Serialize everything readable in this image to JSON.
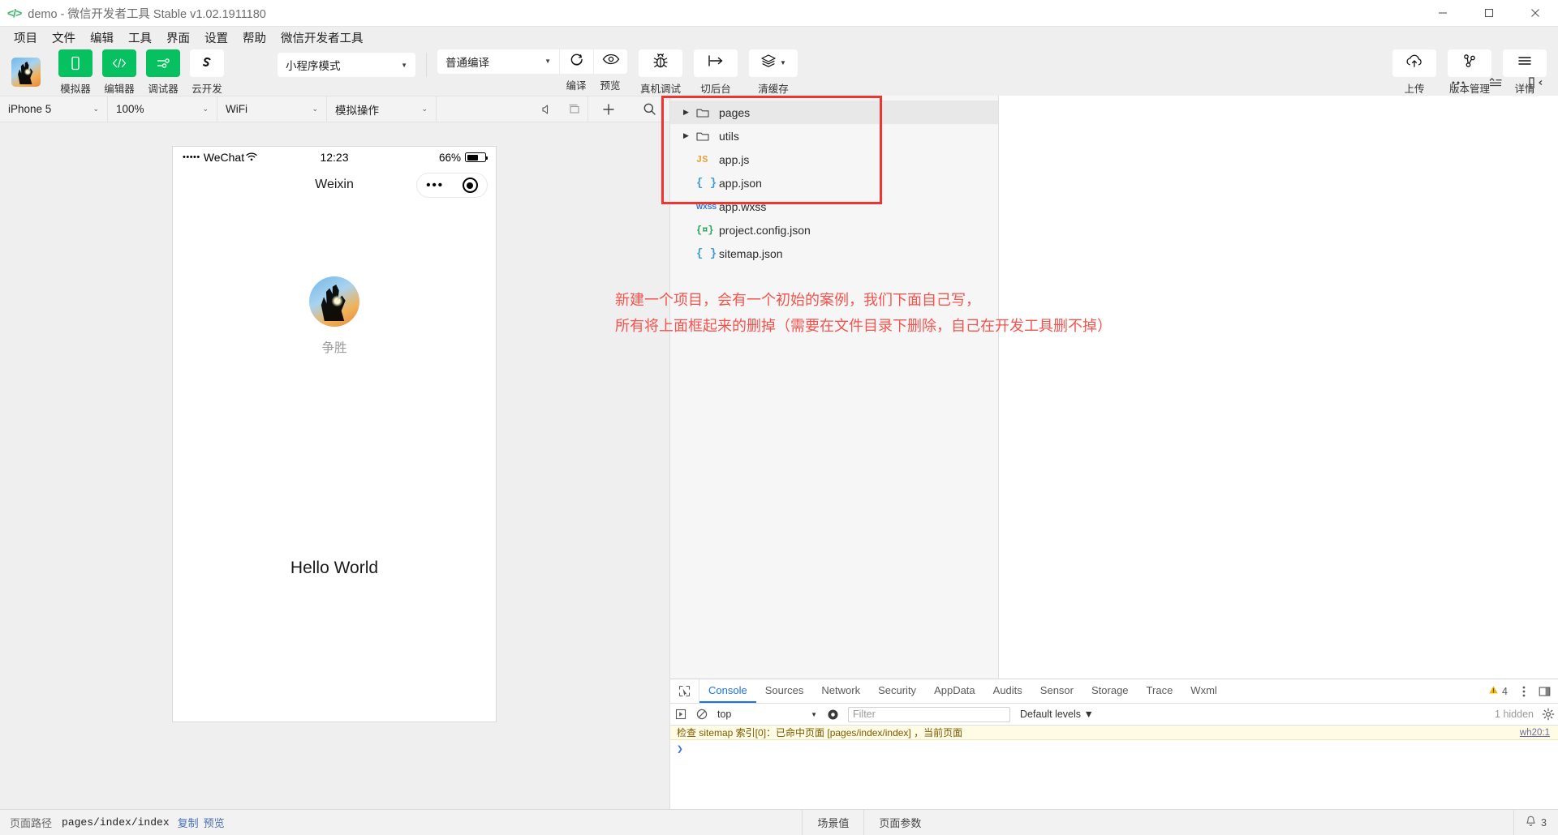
{
  "window": {
    "title": "demo - 微信开发者工具 Stable v1.02.1911180",
    "logo_icon": "code-brackets-icon",
    "minimize_label": "minimize",
    "maximize_label": "maximize",
    "close_label": "close"
  },
  "menubar": {
    "items": [
      "项目",
      "文件",
      "编辑",
      "工具",
      "界面",
      "设置",
      "帮助",
      "微信开发者工具"
    ]
  },
  "toolbar": {
    "avatar_name": "project-avatar",
    "left_buttons": [
      {
        "label": "模拟器",
        "icon": "phone-icon",
        "green": true
      },
      {
        "label": "编辑器",
        "icon": "code-icon",
        "green": true
      },
      {
        "label": "调试器",
        "icon": "sliders-icon",
        "green": true
      },
      {
        "label": "云开发",
        "icon": "cloud-s-icon",
        "green": false
      }
    ],
    "mode_select": {
      "value": "小程序模式",
      "caret": "▼"
    },
    "compile_select": {
      "value": "普通编译",
      "caret": "▼"
    },
    "compile_button": {
      "label": "编译",
      "icon": "refresh-icon"
    },
    "preview_button": {
      "label": "预览",
      "icon": "eye-icon"
    },
    "realdebug_button": {
      "label": "真机调试",
      "icon": "bug-icon"
    },
    "background_button": {
      "label": "切后台",
      "icon": "to-background-icon"
    },
    "clearcache_button": {
      "label": "清缓存",
      "icon": "layers-icon",
      "caret": "▼"
    },
    "right_buttons": [
      {
        "label": "上传",
        "icon": "cloud-upload-icon"
      },
      {
        "label": "版本管理",
        "icon": "git-branch-icon"
      },
      {
        "label": "详情",
        "icon": "hamburger-icon"
      }
    ]
  },
  "simulator_bar": {
    "device": {
      "value": "iPhone 5",
      "chevron": "⌄"
    },
    "zoom": {
      "value": "100%",
      "chevron": "⌄"
    },
    "network": {
      "value": "WiFi",
      "chevron": "⌄"
    },
    "simulate": {
      "value": "模拟操作",
      "chevron": "⌄"
    },
    "icons": [
      "volume-icon",
      "window-icon"
    ]
  },
  "editor_bar": {
    "icons": [
      "add-icon",
      "search-icon",
      "more-icon",
      "collapse-icon",
      "split-panel-icon"
    ]
  },
  "phone": {
    "status": {
      "signal_dots": "•••••",
      "carrier": "WeChat",
      "wifi_icon": "wifi-icon",
      "time": "12:23",
      "battery_percent": "66%"
    },
    "nav_title": "Weixin",
    "capsule": {
      "more_icon": "ellipsis-icon",
      "target_icon": "target-icon"
    },
    "avatar_name": "user-avatar",
    "nickname": "争胜",
    "hello": "Hello World"
  },
  "file_tree": {
    "items": [
      {
        "name": "pages",
        "type": "folder",
        "arrow": "▶",
        "selected": true
      },
      {
        "name": "utils",
        "type": "folder",
        "arrow": "▶",
        "selected": false
      },
      {
        "name": "app.js",
        "type": "js",
        "icon_text": "JS",
        "selected": false
      },
      {
        "name": "app.json",
        "type": "json",
        "icon_text": "{ }",
        "selected": false
      },
      {
        "name": "app.wxss",
        "type": "wxss",
        "icon_text": "WXSS",
        "selected": false
      },
      {
        "name": "project.config.json",
        "type": "cfg",
        "icon_text": "{¤}",
        "selected": false
      },
      {
        "name": "sitemap.json",
        "type": "json",
        "icon_text": "{ }",
        "selected": false
      }
    ],
    "highlight_color": "#f1342e"
  },
  "annotation": {
    "line1": "新建一个项目，会有一个初始的案例，我们下面自己写，",
    "line2": "所有将上面框起来的删掉（需要在文件目录下删除，自己在开发工具删不掉）",
    "color": "#f4534e"
  },
  "devtools": {
    "inspect_icon": "inspect-cursor-icon",
    "tabs": [
      {
        "label": "Console",
        "active": true
      },
      {
        "label": "Sources",
        "active": false
      },
      {
        "label": "Network",
        "active": false
      },
      {
        "label": "Security",
        "active": false
      },
      {
        "label": "AppData",
        "active": false
      },
      {
        "label": "Audits",
        "active": false
      },
      {
        "label": "Sensor",
        "active": false
      },
      {
        "label": "Storage",
        "active": false
      },
      {
        "label": "Trace",
        "active": false
      },
      {
        "label": "Wxml",
        "active": false
      }
    ],
    "warning_count": "4",
    "warning_icon": "warning-triangle-icon",
    "kebab_icon": "more-vertical-icon",
    "dock_icon": "dock-panel-icon",
    "filters": {
      "run_icon": "execute-icon",
      "clear_icon": "clear-console-icon",
      "context": {
        "value": "top",
        "caret": "▼"
      },
      "eye_icon": "live-expression-icon",
      "filter_placeholder": "Filter",
      "filter_value": "",
      "levels": "Default levels ▼",
      "hidden_count": "1 hidden",
      "gear_icon": "settings-gear-icon"
    },
    "log_line": "检查 sitemap 索引[0]：已命中页面 [pages/index/index] ，当前页面",
    "log_source": "wh20:1",
    "prompt": "❯"
  },
  "statusbar": {
    "path_label": "页面路径",
    "path_value": "pages/index/index",
    "copy_link": "复制",
    "preview_link": "预览",
    "scene_cell": "场景值",
    "params_cell": "页面参数",
    "bell_icon": "bell-icon",
    "bell_count": "3"
  }
}
